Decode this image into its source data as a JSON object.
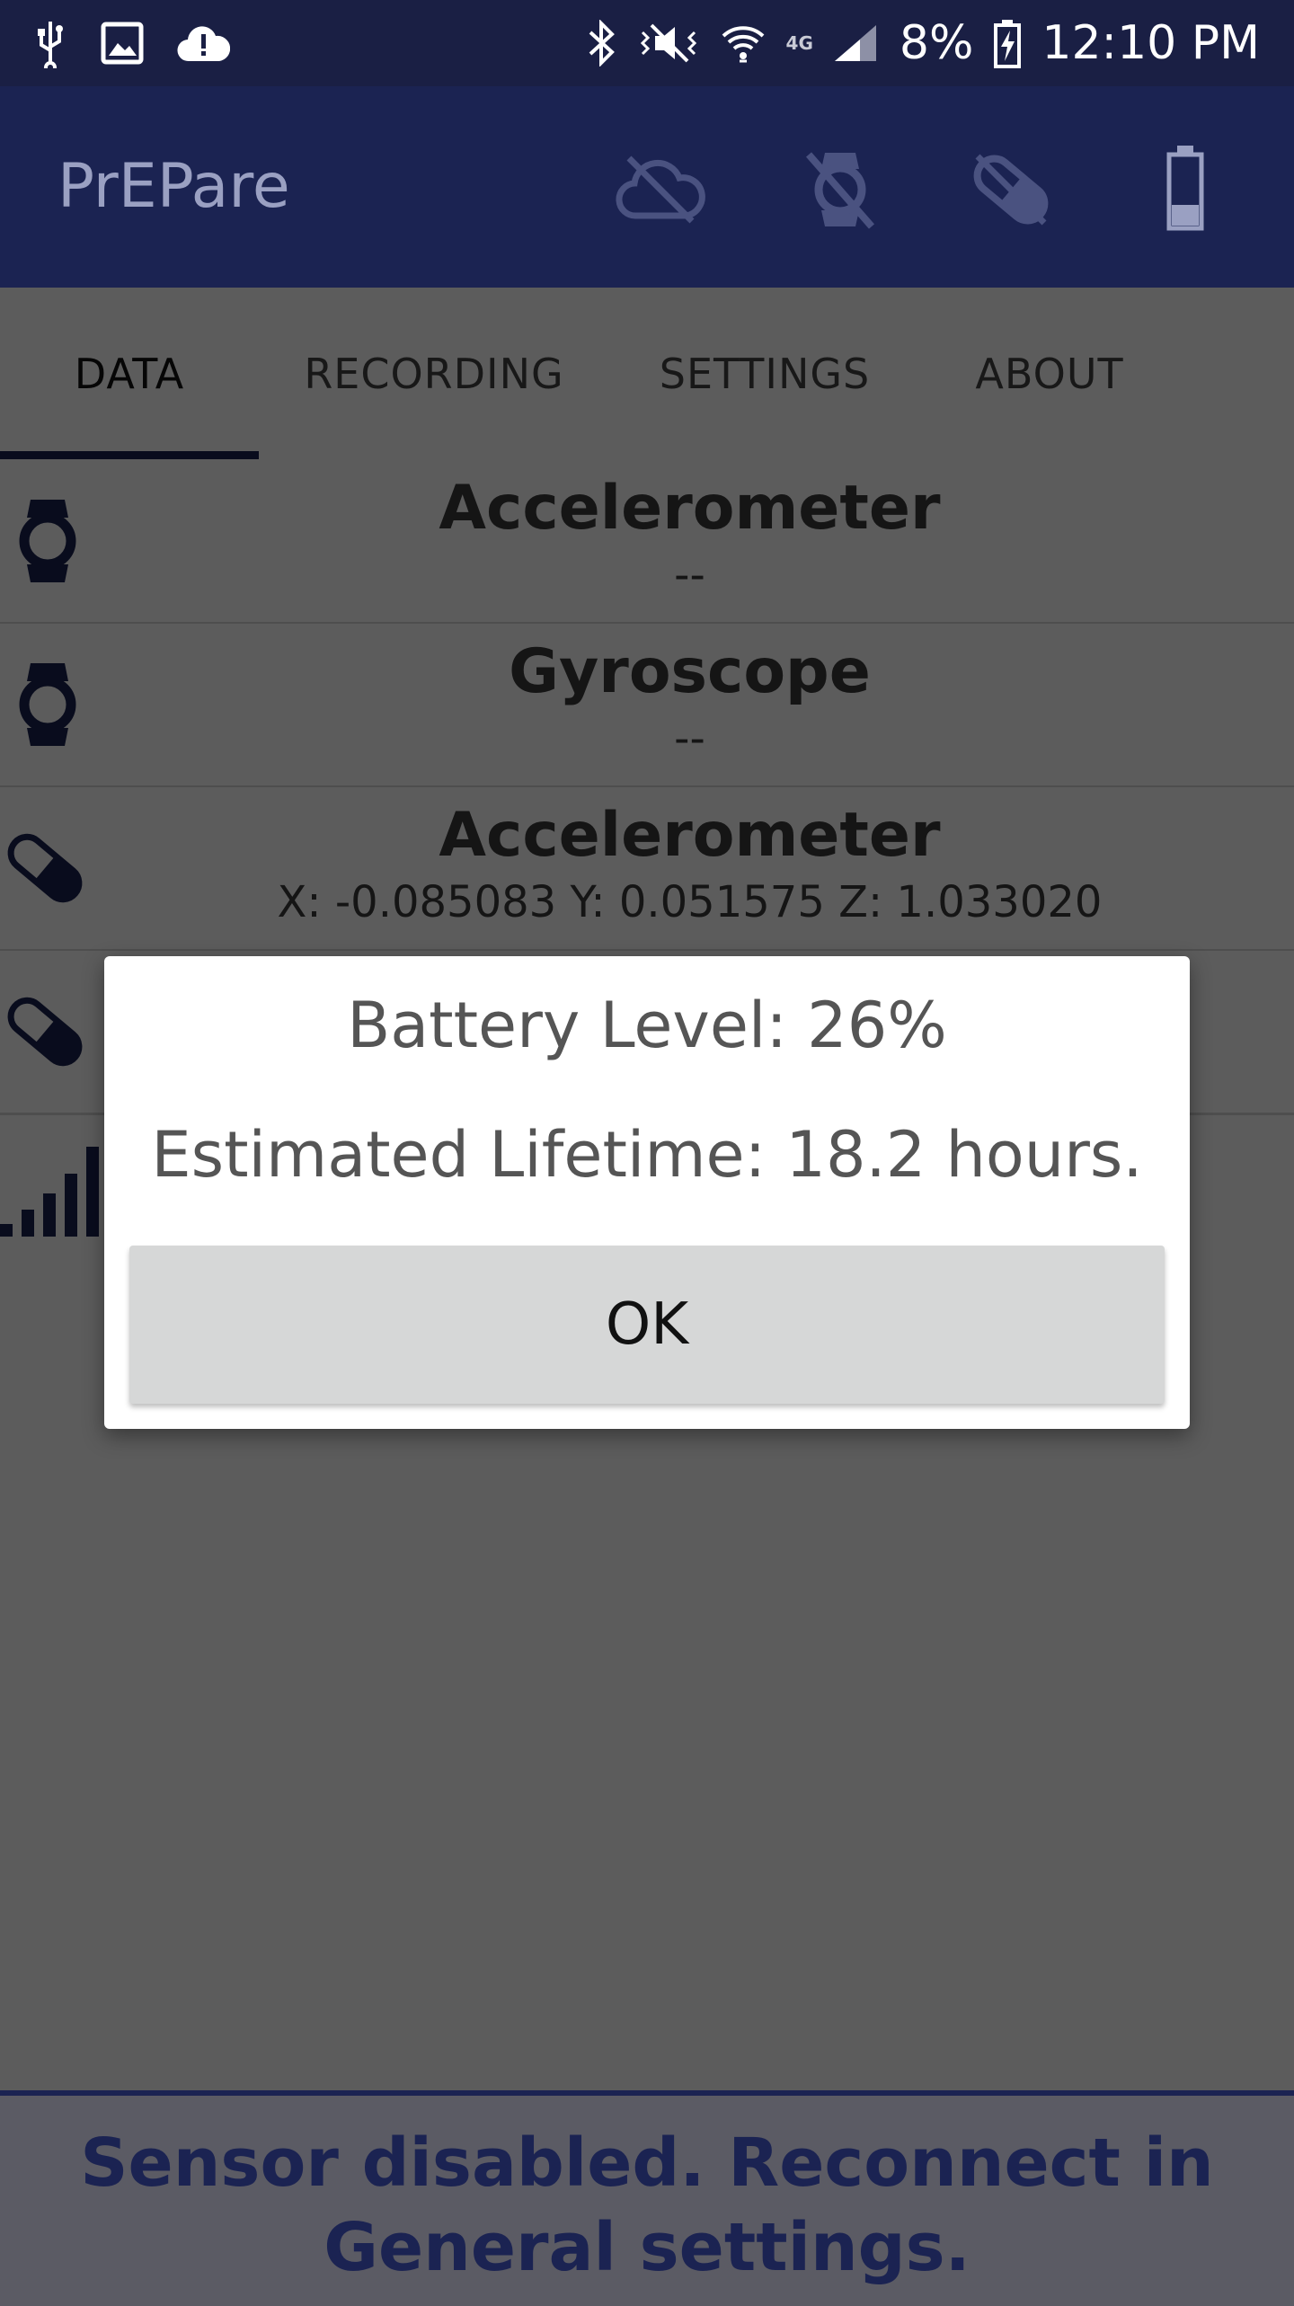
{
  "status_bar": {
    "battery_percent": "8%",
    "time": "12:10 PM",
    "network": "4G",
    "left_icons": [
      "usb-icon",
      "image-icon",
      "cloud-alert-icon"
    ],
    "right_icons": [
      "bluetooth-icon",
      "vibrate-mute-icon",
      "wifi-icon",
      "cell-signal-icon",
      "battery-charging-icon"
    ]
  },
  "app_bar": {
    "title": "PrEPare",
    "actions": [
      "cloud-off-icon",
      "watch-off-icon",
      "pill-off-icon",
      "battery-icon"
    ]
  },
  "tabs": [
    {
      "label": "DATA",
      "active": true
    },
    {
      "label": "RECORDING",
      "active": false
    },
    {
      "label": "SETTINGS",
      "active": false
    },
    {
      "label": "ABOUT",
      "active": false
    }
  ],
  "sensors": [
    {
      "icon": "watch-icon",
      "title": "Accelerometer",
      "value": "--"
    },
    {
      "icon": "watch-icon",
      "title": "Gyroscope",
      "value": "--"
    },
    {
      "icon": "pill-icon",
      "title": "Accelerometer",
      "value": "X: -0.085083 Y: 0.051575 Z: 1.033020"
    },
    {
      "icon": "pill-icon",
      "title": "",
      "value": ""
    }
  ],
  "dialog": {
    "battery_line": "Battery Level: 26%",
    "lifetime_line": "Estimated Lifetime: 18.2 hours.",
    "ok_label": "OK"
  },
  "footer": {
    "message": "Sensor disabled. Reconnect in General settings."
  },
  "colors": {
    "primary": "#1b2352",
    "status_bar": "#1a1f44",
    "scrim": "#5b5b64",
    "button": "#d6d7d7"
  }
}
